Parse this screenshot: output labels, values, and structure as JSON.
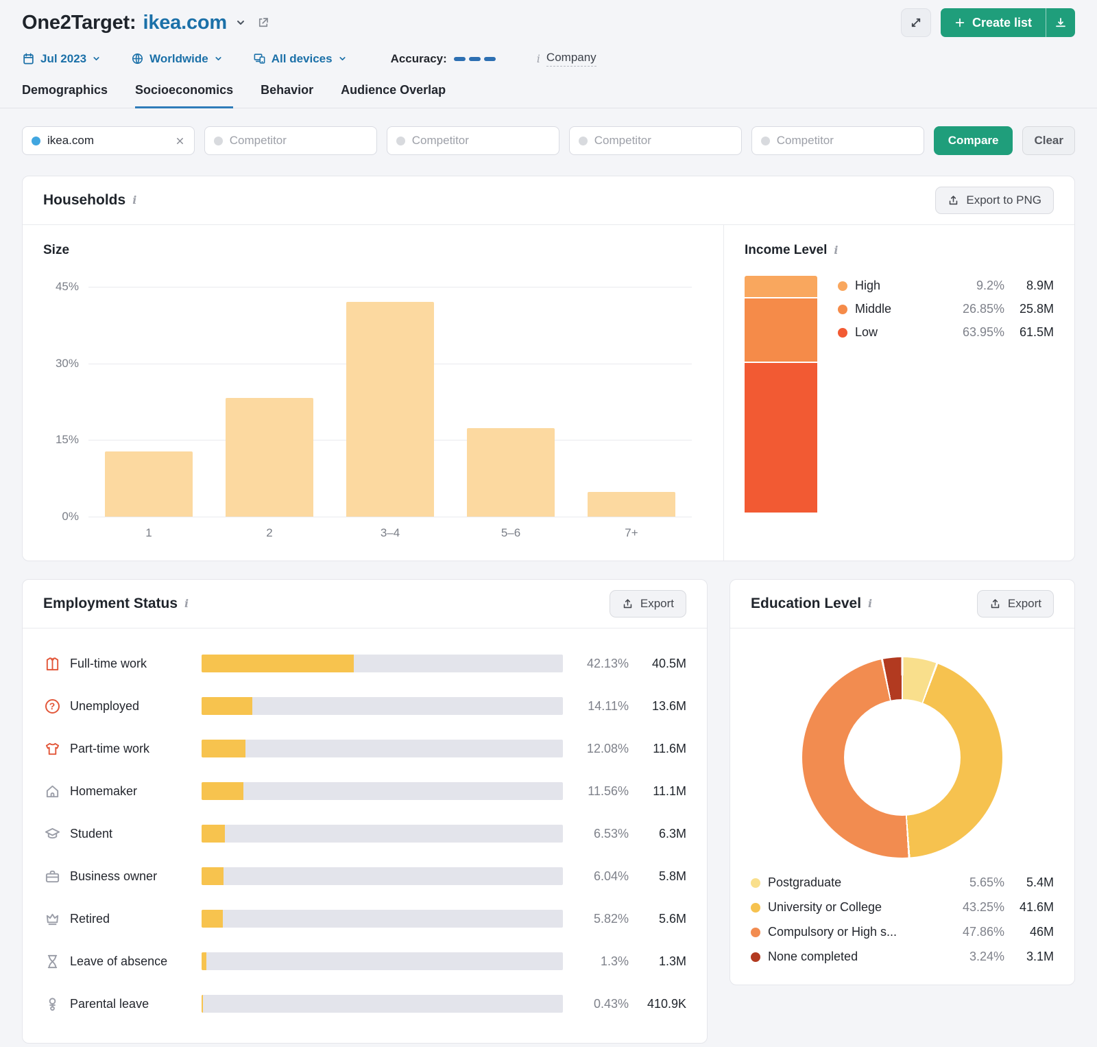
{
  "header": {
    "title_prefix": "One2Target:",
    "domain": "ikea.com",
    "create_list_label": "Create list",
    "filters": {
      "date": "Jul 2023",
      "region": "Worldwide",
      "devices": "All devices",
      "accuracy_label": "Accuracy:",
      "company_label": "Company"
    },
    "tabs": [
      {
        "id": "demographics",
        "label": "Demographics",
        "active": false
      },
      {
        "id": "socioeconomics",
        "label": "Socioeconomics",
        "active": true
      },
      {
        "id": "behavior",
        "label": "Behavior",
        "active": false
      },
      {
        "id": "audience-overlap",
        "label": "Audience Overlap",
        "active": false
      }
    ]
  },
  "compare_bar": {
    "selected_domain": "ikea.com",
    "competitor_placeholder": "Competitor",
    "competitor_count": 4,
    "compare_label": "Compare",
    "clear_label": "Clear"
  },
  "households": {
    "title": "Households",
    "export_label": "Export to PNG",
    "size_chart": {
      "type": "bar",
      "title": "Size",
      "categories": [
        "1",
        "2",
        "3–4",
        "5–6",
        "7+"
      ],
      "values": [
        12.7,
        23.3,
        42.1,
        17.3,
        4.9
      ],
      "yticks": [
        45,
        30,
        15,
        0
      ],
      "ylim": [
        0,
        45
      ],
      "bar_color": "#fcd9a0",
      "grid": true
    },
    "income_chart": {
      "type": "stacked-bar",
      "title": "Income Level",
      "slices": [
        {
          "label": "High",
          "pct": 9.2,
          "pct_label": "9.2%",
          "value": "8.9M",
          "color": "#f9a75e"
        },
        {
          "label": "Middle",
          "pct": 26.85,
          "pct_label": "26.85%",
          "value": "25.8M",
          "color": "#f58b49"
        },
        {
          "label": "Low",
          "pct": 63.95,
          "pct_label": "63.95%",
          "value": "61.5M",
          "color": "#f25a33"
        }
      ]
    }
  },
  "employment": {
    "title": "Employment Status",
    "export_label": "Export",
    "chart_type": "hbar",
    "bar_color": "#f7c34e",
    "rows": [
      {
        "icon": "full-time-work-icon",
        "label": "Full-time work",
        "pct": 42.13,
        "pct_label": "42.13%",
        "value": "40.5M"
      },
      {
        "icon": "unemployed-icon",
        "label": "Unemployed",
        "pct": 14.11,
        "pct_label": "14.11%",
        "value": "13.6M"
      },
      {
        "icon": "part-time-work-icon",
        "label": "Part-time work",
        "pct": 12.08,
        "pct_label": "12.08%",
        "value": "11.6M"
      },
      {
        "icon": "homemaker-icon",
        "label": "Homemaker",
        "pct": 11.56,
        "pct_label": "11.56%",
        "value": "11.1M"
      },
      {
        "icon": "student-icon",
        "label": "Student",
        "pct": 6.53,
        "pct_label": "6.53%",
        "value": "6.3M"
      },
      {
        "icon": "business-owner-icon",
        "label": "Business owner",
        "pct": 6.04,
        "pct_label": "6.04%",
        "value": "5.8M"
      },
      {
        "icon": "retired-icon",
        "label": "Retired",
        "pct": 5.82,
        "pct_label": "5.82%",
        "value": "5.6M"
      },
      {
        "icon": "leave-of-absence-icon",
        "label": "Leave of absence",
        "pct": 1.3,
        "pct_label": "1.3%",
        "value": "1.3M"
      },
      {
        "icon": "parental-leave-icon",
        "label": "Parental leave",
        "pct": 0.43,
        "pct_label": "0.43%",
        "value": "410.9K"
      }
    ]
  },
  "education": {
    "title": "Education Level",
    "export_label": "Export",
    "chart_type": "donut",
    "slices": [
      {
        "label": "Postgraduate",
        "pct": 5.65,
        "pct_label": "5.65%",
        "value": "5.4M",
        "color": "#f9df8c"
      },
      {
        "label": "University or College",
        "pct": 43.25,
        "pct_label": "43.25%",
        "value": "41.6M",
        "color": "#f6c24f"
      },
      {
        "label": "Compulsory or High s...",
        "pct": 47.86,
        "pct_label": "47.86%",
        "value": "46M",
        "color": "#f28c50"
      },
      {
        "label": "None completed",
        "pct": 3.24,
        "pct_label": "3.24%",
        "value": "3.1M",
        "color": "#b23a20"
      }
    ]
  }
}
